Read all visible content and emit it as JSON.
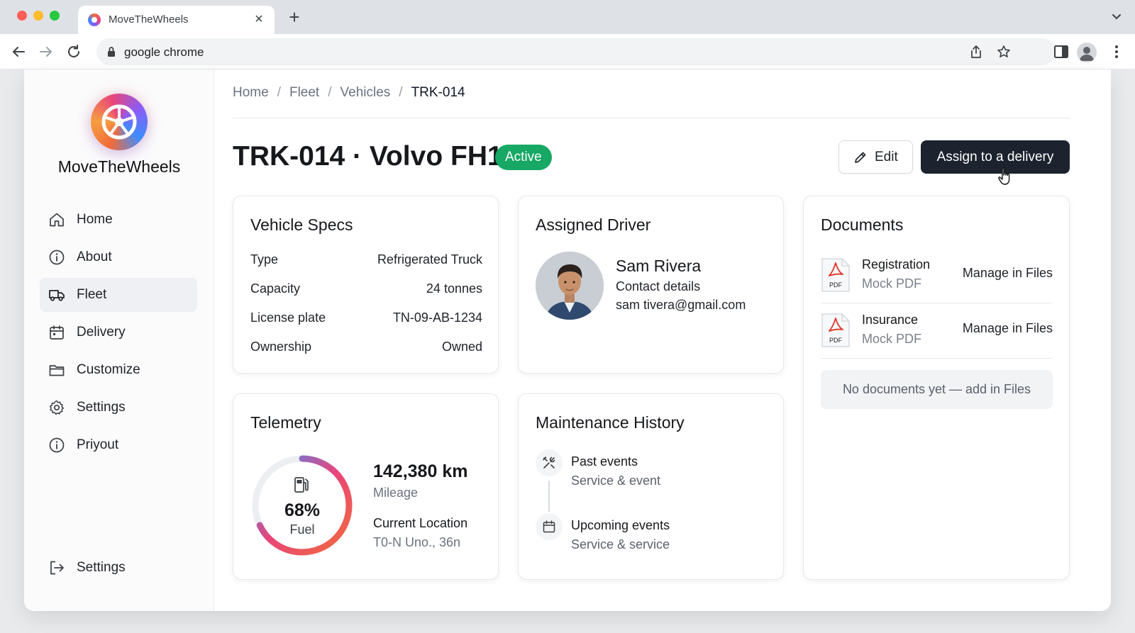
{
  "browser": {
    "tab_title": "MoveTheWheels",
    "url": "google chrome",
    "colors": {
      "close": "#ff5f57",
      "minimize": "#febc2e",
      "maximize": "#28c840"
    }
  },
  "app": {
    "brand": "MoveTheWheels",
    "sidebar": {
      "items": [
        {
          "label": "Home",
          "icon": "home-icon"
        },
        {
          "label": "About",
          "icon": "info-icon"
        },
        {
          "label": "Fleet",
          "icon": "truck-icon",
          "active": true
        },
        {
          "label": "Delivery",
          "icon": "calendar-icon"
        },
        {
          "label": "Customize",
          "icon": "folder-icon"
        },
        {
          "label": "Settings",
          "icon": "gear-icon"
        },
        {
          "label": "Priyout",
          "icon": "info-icon"
        }
      ],
      "footer": {
        "label": "Settings",
        "icon": "logout-icon"
      }
    },
    "breadcrumb": [
      "Home",
      "Fleet",
      "Vehicles",
      "TRK-014"
    ],
    "page_title": "TRK-014 · Volvo FH16",
    "status": "Active",
    "actions": {
      "edit": "Edit",
      "assign": "Assign to a delivery"
    },
    "vehicle_specs": {
      "title": "Vehicle Specs",
      "rows": [
        {
          "label": "Type",
          "value": "Refrigerated Truck"
        },
        {
          "label": "Capacity",
          "value": "24 tonnes"
        },
        {
          "label": "License plate",
          "value": "TN-09-AB-1234"
        },
        {
          "label": "Ownership",
          "value": "Owned"
        }
      ]
    },
    "driver": {
      "title": "Assigned Driver",
      "name": "Sam Rivera",
      "contact_label": "Contact details",
      "email": "sam tivera@gmail.com"
    },
    "documents": {
      "title": "Documents",
      "items": [
        {
          "name": "Registration",
          "type": "Mock PDF",
          "action": "Manage in Files",
          "icon_label": "PDF"
        },
        {
          "name": "Insurance",
          "type": "Mock PDF",
          "action": "Manage in Files",
          "icon_label": "PDF"
        }
      ],
      "empty": "No documents yet — add in Files"
    },
    "telemetry": {
      "title": "Telemetry",
      "fuel_value": 0.68,
      "fuel_percent": "68%",
      "fuel_label": "Fuel",
      "mileage": "142,380 km",
      "mileage_label": "Mileage",
      "location_label": "Current Location",
      "location": "T0-N Uno., 36n"
    },
    "maintenance": {
      "title": "Maintenance History",
      "items": [
        {
          "title": "Past events",
          "subtitle": "Service & event",
          "icon": "tools-icon"
        },
        {
          "title": "Upcoming events",
          "subtitle": "Service & service",
          "icon": "calendar-icon"
        }
      ]
    },
    "colors": {
      "accent": "#1c232e",
      "active_badge": "#16a864",
      "gauge_start": "#f26b3a",
      "gauge_mid": "#e8457a",
      "gauge_end": "#3f8cff"
    }
  }
}
